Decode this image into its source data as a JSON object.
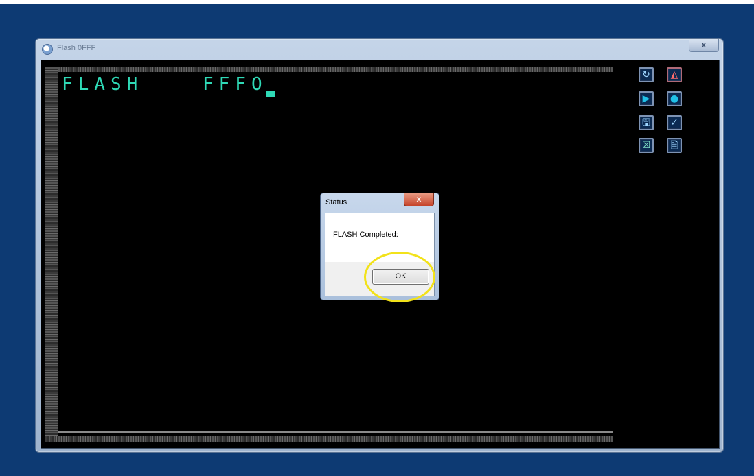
{
  "window": {
    "title": "Flash 0FFF",
    "close_glyph": "x"
  },
  "screen": {
    "mode_text": "FLASH",
    "address_text": "FFFO"
  },
  "toolbar": {
    "buttons": [
      {
        "name": "refresh-icon",
        "glyph": "↻"
      },
      {
        "name": "chart-icon",
        "glyph": "◭"
      },
      {
        "name": "play-icon",
        "glyph": "▶"
      },
      {
        "name": "record-icon",
        "glyph": "●"
      },
      {
        "name": "save-icon",
        "glyph": "🖫"
      },
      {
        "name": "check-icon",
        "glyph": "✓"
      },
      {
        "name": "cancel-icon",
        "glyph": "☒"
      },
      {
        "name": "document-icon",
        "glyph": "🗎"
      }
    ]
  },
  "dialog": {
    "title": "Status",
    "close_glyph": "x",
    "message": "FLASH Completed:",
    "ok_label": "OK"
  },
  "colors": {
    "desktop": "#0d3a73",
    "terminal_text": "#2fd9b6",
    "highlight": "#f2e21a"
  }
}
